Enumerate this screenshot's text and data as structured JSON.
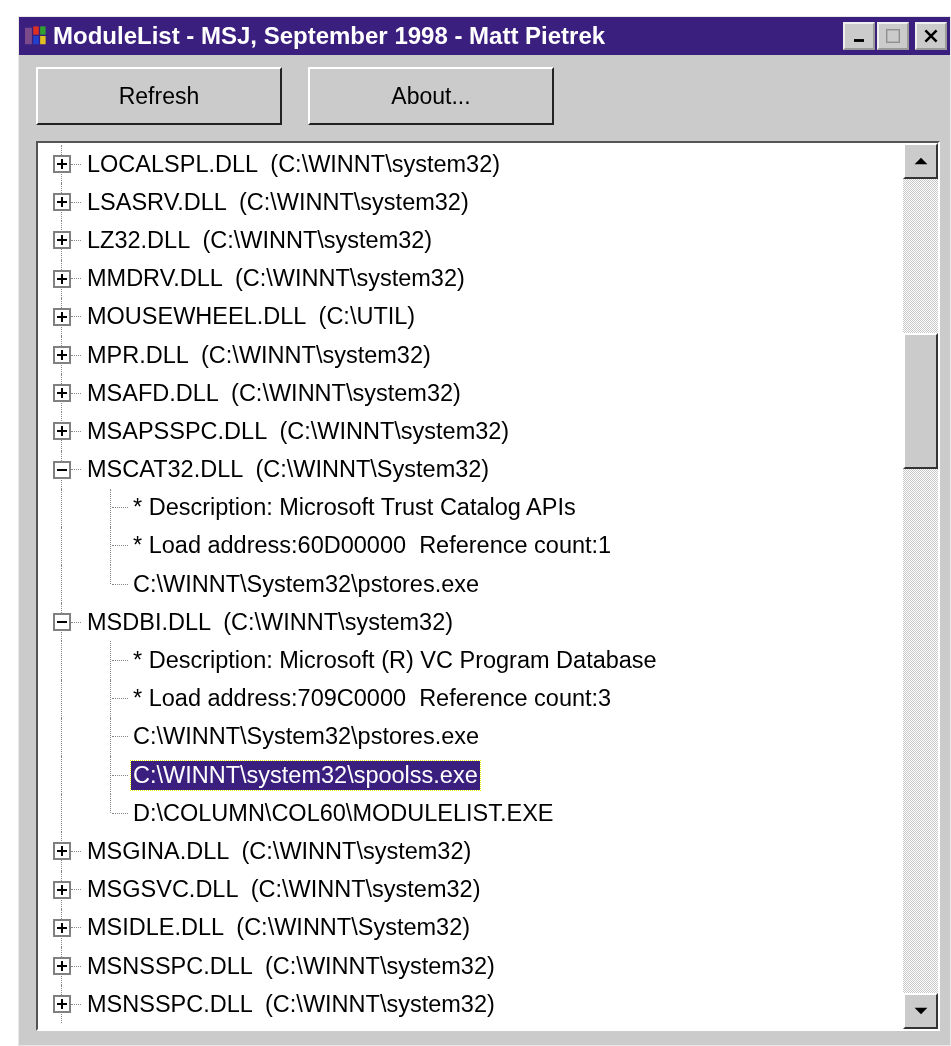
{
  "window": {
    "title": "ModuleList - MSJ, September 1998 - Matt Pietrek"
  },
  "buttons": [
    "Refresh",
    "About..."
  ],
  "tree": [
    {
      "label": "LOCALSPL.DLL  (C:\\WINNT\\system32)",
      "expanded": false,
      "selected": false
    },
    {
      "label": "LSASRV.DLL  (C:\\WINNT\\system32)",
      "expanded": false,
      "selected": false
    },
    {
      "label": "LZ32.DLL  (C:\\WINNT\\system32)",
      "expanded": false,
      "selected": false
    },
    {
      "label": "MMDRV.DLL  (C:\\WINNT\\system32)",
      "expanded": false,
      "selected": false
    },
    {
      "label": "MOUSEWHEEL.DLL  (C:\\UTIL)",
      "expanded": false,
      "selected": false
    },
    {
      "label": "MPR.DLL  (C:\\WINNT\\system32)",
      "expanded": false,
      "selected": false
    },
    {
      "label": "MSAFD.DLL  (C:\\WINNT\\system32)",
      "expanded": false,
      "selected": false
    },
    {
      "label": "MSAPSSPC.DLL  (C:\\WINNT\\system32)",
      "expanded": false,
      "selected": false
    },
    {
      "label": "MSCAT32.DLL  (C:\\WINNT\\System32)",
      "expanded": true,
      "selected": false,
      "children": [
        {
          "label": "* Description: Microsoft Trust Catalog APIs",
          "selected": false
        },
        {
          "label": "* Load address:60D00000  Reference count:1",
          "selected": false
        },
        {
          "label": "C:\\WINNT\\System32\\pstores.exe",
          "selected": false
        }
      ]
    },
    {
      "label": "MSDBI.DLL  (C:\\WINNT\\system32)",
      "expanded": true,
      "selected": false,
      "children": [
        {
          "label": "* Description: Microsoft (R) VC Program Database",
          "selected": false
        },
        {
          "label": "* Load address:709C0000  Reference count:3",
          "selected": false
        },
        {
          "label": "C:\\WINNT\\System32\\pstores.exe",
          "selected": false
        },
        {
          "label": "C:\\WINNT\\system32\\spoolss.exe",
          "selected": true
        },
        {
          "label": "D:\\COLUMN\\COL60\\MODULELIST.EXE",
          "selected": false
        }
      ]
    },
    {
      "label": "MSGINA.DLL  (C:\\WINNT\\system32)",
      "expanded": false,
      "selected": false
    },
    {
      "label": "MSGSVC.DLL  (C:\\WINNT\\system32)",
      "expanded": false,
      "selected": false
    },
    {
      "label": "MSIDLE.DLL  (C:\\WINNT\\System32)",
      "expanded": false,
      "selected": false
    },
    {
      "label": "MSNSSPC.DLL  (C:\\WINNT\\system32)",
      "expanded": false,
      "selected": false
    },
    {
      "label": "MSNSSPC.DLL  (C:\\WINNT\\system32)",
      "expanded": false,
      "selected": false
    }
  ]
}
